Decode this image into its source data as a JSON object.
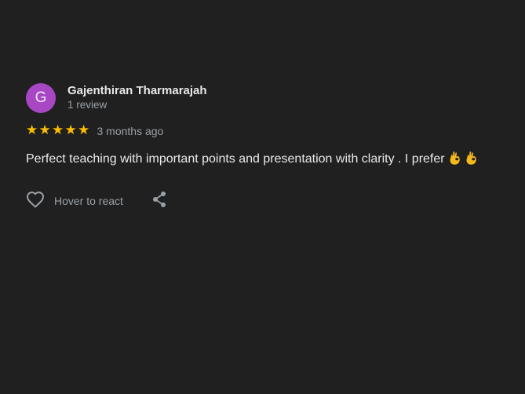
{
  "review": {
    "avatar_initial": "G",
    "author_name": "Gajenthiran Tharmarajah",
    "author_meta": "1 review",
    "rating": 5,
    "rating_max": 5,
    "time_ago": "3 months ago",
    "text": "Perfect teaching with important points and presentation with clarity . I prefer",
    "emojis": [
      "ok-hand-emoji",
      "ok-hand-emoji"
    ]
  },
  "actions": {
    "react_label": "Hover to react",
    "react_icon": "heart-outline-icon",
    "share_icon": "share-icon"
  },
  "colors": {
    "background": "#202020",
    "avatar": "#a847c4",
    "star": "#fbbc04",
    "muted_text": "#9aa0a6",
    "primary_text": "#e8eaed"
  }
}
